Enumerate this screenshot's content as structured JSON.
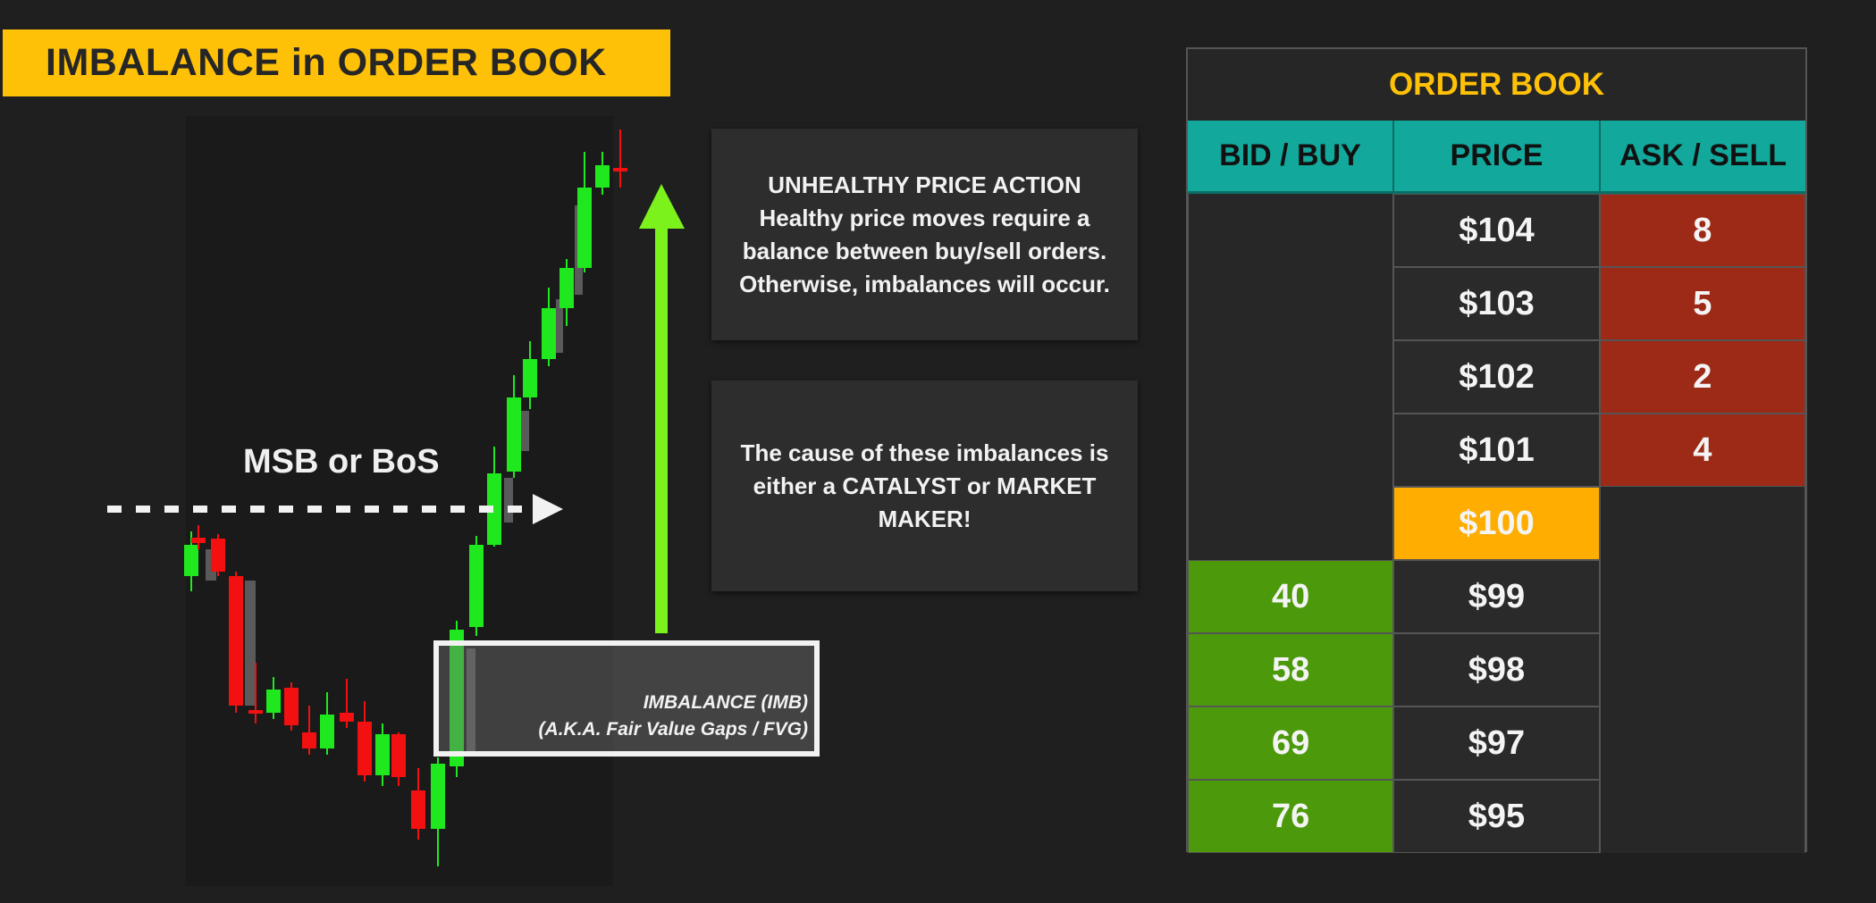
{
  "title": "IMBALANCE in ORDER BOOK",
  "chart": {
    "msb_label": "MSB or BoS",
    "imbalance_label_line1": "IMBALANCE  (IMB)",
    "imbalance_label_line2": "(A.K.A. Fair Value Gaps / FVG)",
    "colors": {
      "bull": "#1fe81f",
      "bear": "#f21010",
      "shadow": "#5a5a5a",
      "arrow": "#7cf21c"
    }
  },
  "info_boxes": [
    {
      "heading": "UNHEALTHY PRICE ACTION",
      "lines": [
        "Healthy price moves require a",
        "balance between buy/sell orders.",
        "Otherwise, imbalances will occur."
      ]
    },
    {
      "lines": [
        "The cause of these imbalances is",
        "either a CATALYST or MARKET",
        "MAKER!"
      ]
    }
  ],
  "order_book": {
    "title": "ORDER BOOK",
    "headers": [
      "BID / BUY",
      "PRICE",
      "ASK / SELL"
    ],
    "rows": [
      {
        "bid": "",
        "price": "$104",
        "ask": "8"
      },
      {
        "bid": "",
        "price": "$103",
        "ask": "5"
      },
      {
        "bid": "",
        "price": "$102",
        "ask": "2"
      },
      {
        "bid": "",
        "price": "$101",
        "ask": "4"
      },
      {
        "bid": "",
        "price": "$100",
        "ask": "",
        "current": true
      },
      {
        "bid": "40",
        "price": "$99",
        "ask": ""
      },
      {
        "bid": "58",
        "price": "$98",
        "ask": ""
      },
      {
        "bid": "69",
        "price": "$97",
        "ask": ""
      },
      {
        "bid": "76",
        "price": "$95",
        "ask": ""
      }
    ],
    "colors": {
      "header": "#12a89c",
      "ask": "#9c2a16",
      "bid": "#4c9a0b",
      "current": "#ffad00",
      "title": "#ffc107"
    }
  }
}
